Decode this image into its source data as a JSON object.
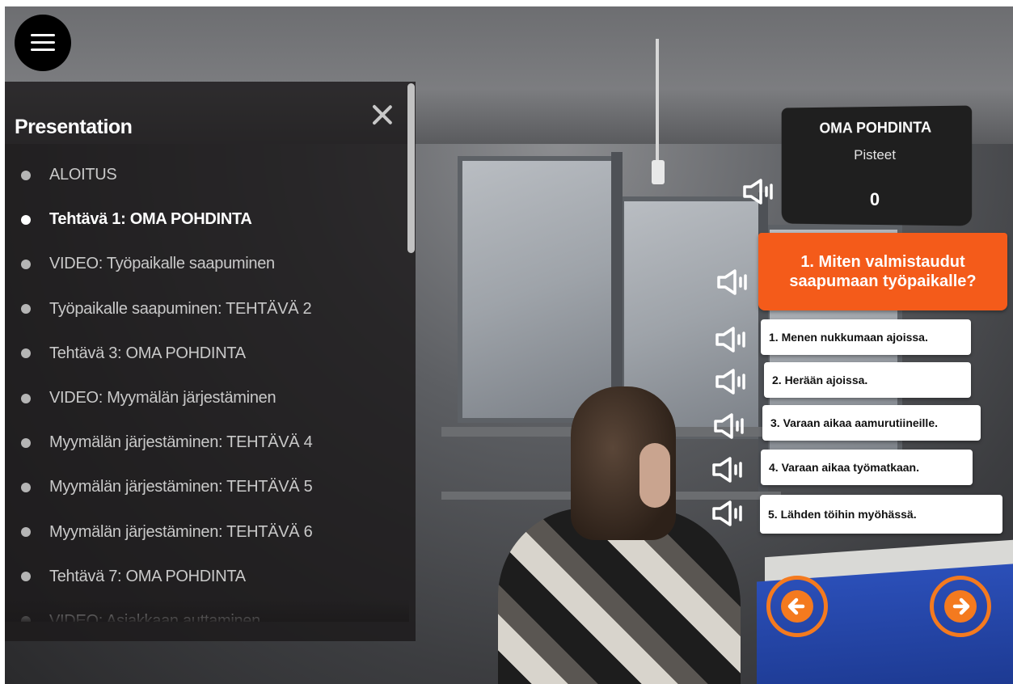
{
  "menu": {
    "icon": "hamburger-menu-icon"
  },
  "sidebar": {
    "title": "Presentation",
    "close_icon": "close-icon",
    "items": [
      {
        "label": "ALOITUS",
        "active": false
      },
      {
        "label": "Tehtävä 1: OMA POHDINTA",
        "active": true
      },
      {
        "label": "VIDEO: Työpaikalle saapuminen",
        "active": false
      },
      {
        "label": "Työpaikalle saapuminen: TEHTÄVÄ 2",
        "active": false
      },
      {
        "label": "Tehtävä 3: OMA POHDINTA",
        "active": false
      },
      {
        "label": "VIDEO: Myymälän järjestäminen",
        "active": false
      },
      {
        "label": "Myymälän järjestäminen: TEHTÄVÄ 4",
        "active": false
      },
      {
        "label": "Myymälän järjestäminen: TEHTÄVÄ 5",
        "active": false
      },
      {
        "label": "Myymälän järjestäminen: TEHTÄVÄ 6",
        "active": false
      },
      {
        "label": "Tehtävä 7: OMA POHDINTA",
        "active": false
      },
      {
        "label": "VIDEO: Asiakkaan auttaminen",
        "active": false
      }
    ]
  },
  "score": {
    "title": "OMA POHDINTA",
    "label": "Pisteet",
    "value": "0"
  },
  "question": {
    "text": "1. Miten valmistaudut saapumaan työpaikalle?"
  },
  "answers": [
    {
      "text": "1. Menen nukkumaan ajoissa."
    },
    {
      "text": "2. Herään ajoissa."
    },
    {
      "text": "3. Varaan aikaa aamurutiineille."
    },
    {
      "text": "4. Varaan aikaa työmatkaan."
    },
    {
      "text": "5. Lähden töihin myöhässä."
    }
  ],
  "icons": {
    "speaker": "speaker-icon",
    "prev": "arrow-left-icon",
    "next": "arrow-right-icon"
  },
  "colors": {
    "accent": "#f45b1a",
    "arrow": "#f47a1f",
    "sidebar_bg": "#1c1a1b",
    "score_bg": "#1f1f1f"
  }
}
